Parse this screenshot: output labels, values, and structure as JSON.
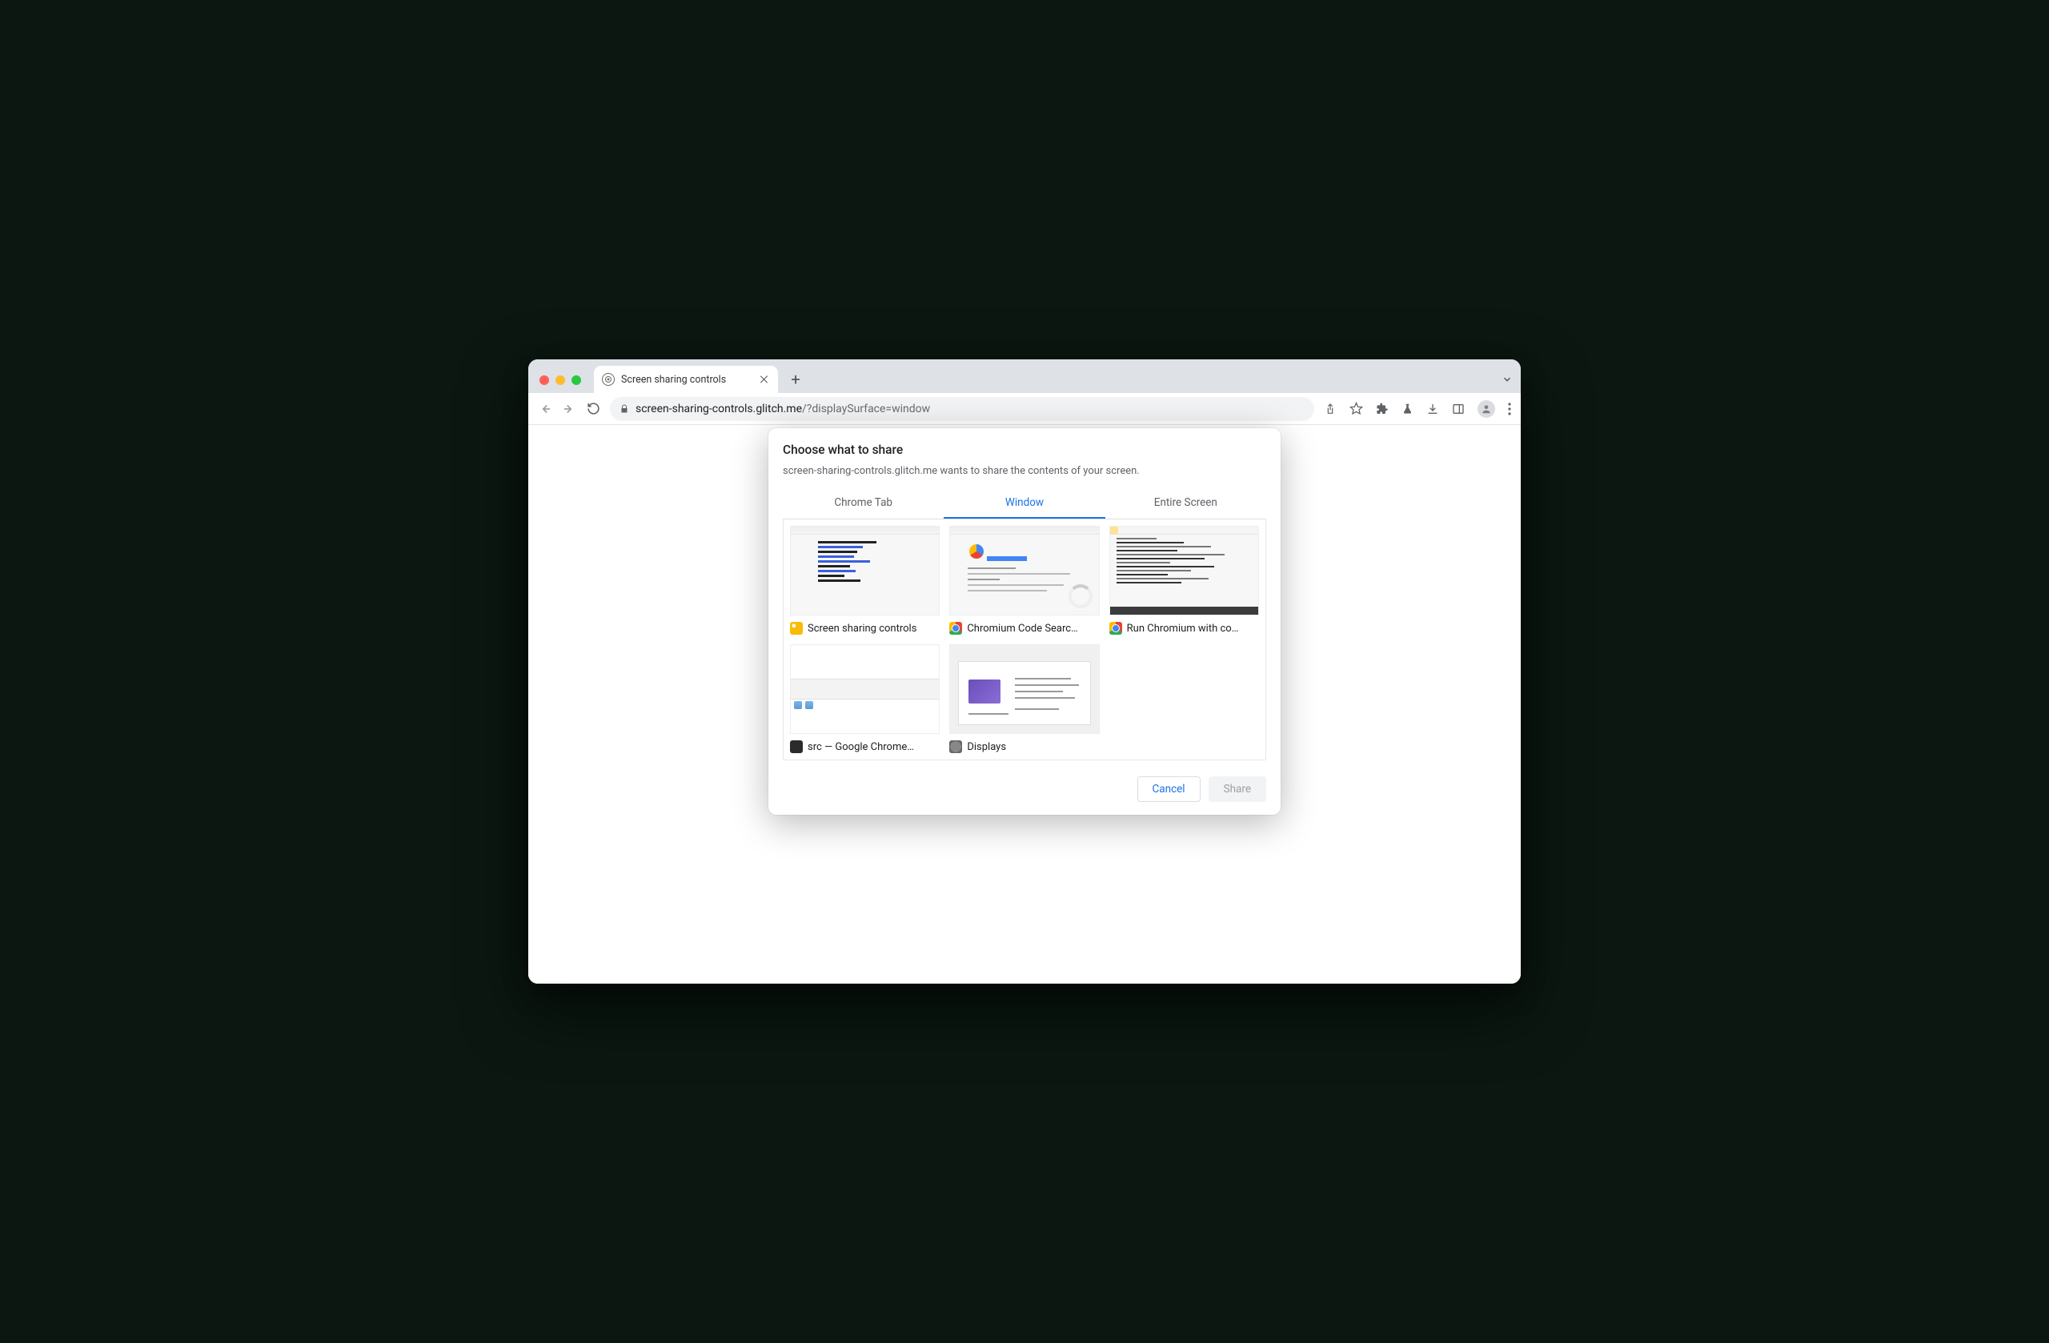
{
  "tab": {
    "title": "Screen sharing controls"
  },
  "url": {
    "host": "screen-sharing-controls.glitch.me",
    "query": "/?displaySurface=window"
  },
  "dialog": {
    "title": "Choose what to share",
    "subtitle": "screen-sharing-controls.glitch.me wants to share the contents of your screen.",
    "tabs": {
      "chrome_tab": "Chrome Tab",
      "window": "Window",
      "entire_screen": "Entire Screen"
    },
    "items": [
      {
        "label": "Screen sharing controls",
        "icon": "canary"
      },
      {
        "label": "Chromium Code Searc…",
        "icon": "chrome"
      },
      {
        "label": "Run Chromium with co…",
        "icon": "chrome"
      },
      {
        "label": "src — Google Chrome…",
        "icon": "terminal"
      },
      {
        "label": "Displays",
        "icon": "system-prefs"
      }
    ],
    "actions": {
      "cancel": "Cancel",
      "share": "Share"
    }
  }
}
